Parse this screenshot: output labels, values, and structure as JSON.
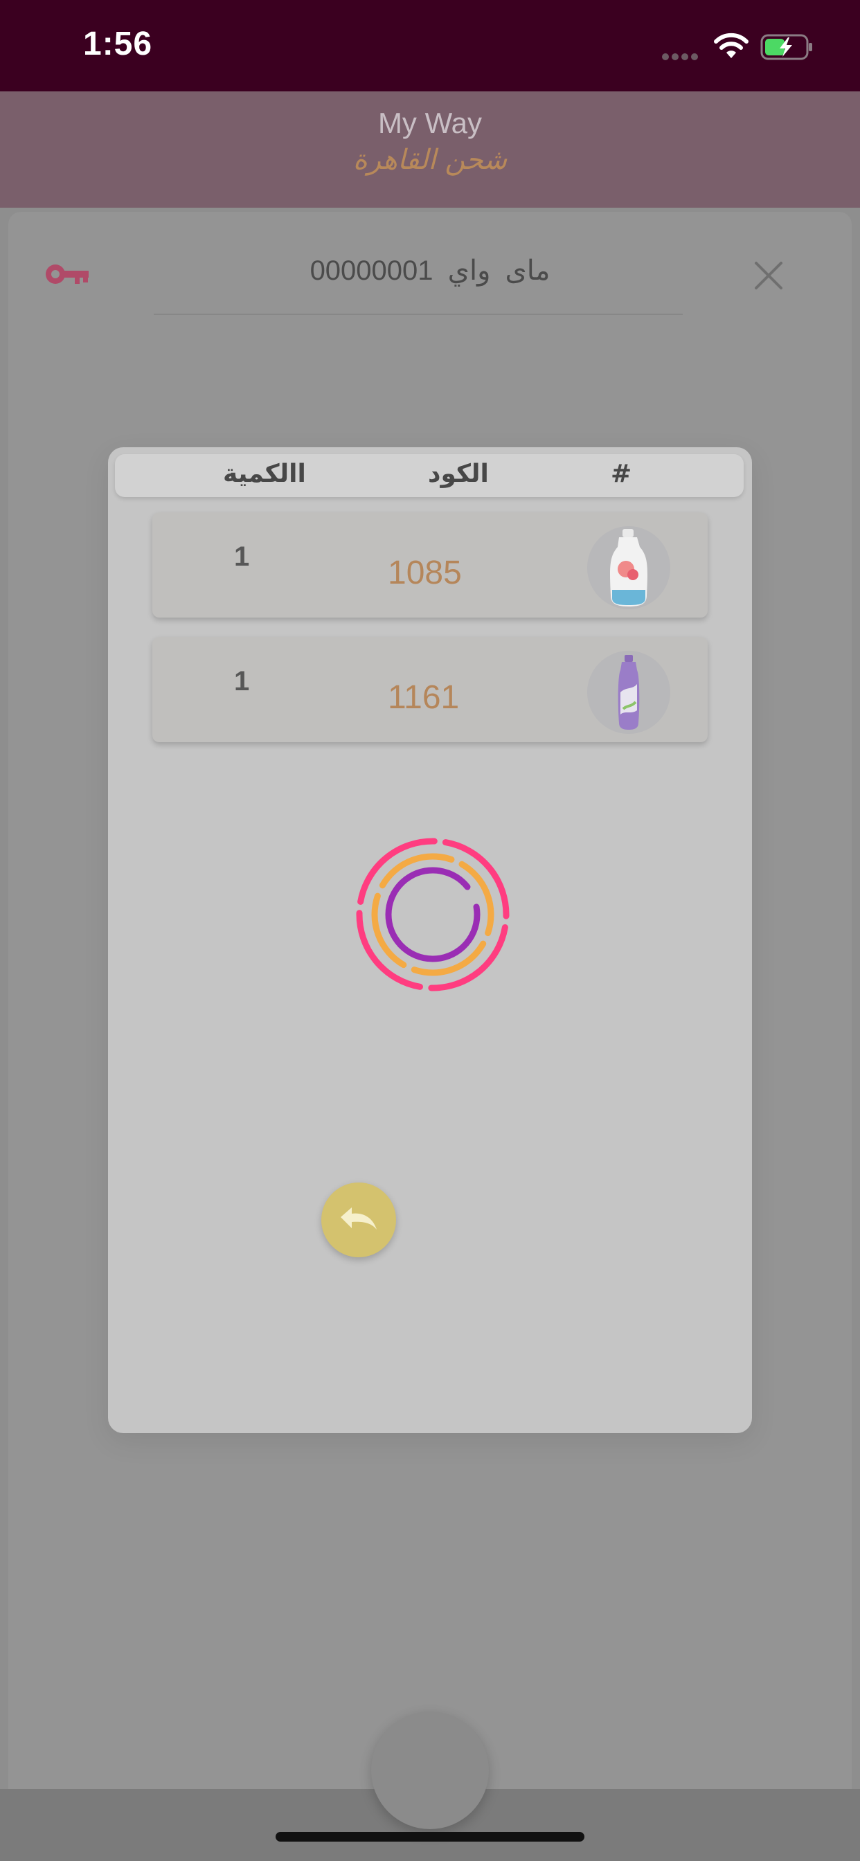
{
  "status_bar": {
    "time": "1:56",
    "icons": [
      "signal-dots-icon",
      "wifi-icon",
      "battery-charging-icon"
    ]
  },
  "header": {
    "title": "My Way",
    "subtitle": "شحن القاهرة"
  },
  "sheet": {
    "title": "ماى واي   00000001",
    "left_icon": "key-icon",
    "right_icon": "close-icon"
  },
  "table": {
    "columns": [
      "االكمية",
      "الكود",
      "#"
    ],
    "rows": [
      {
        "quantity": "1",
        "code": "1085",
        "image": "detergent-bottle-image"
      },
      {
        "quantity": "1",
        "code": "1161",
        "image": "purple-bottle-image"
      }
    ]
  },
  "loading_spinner": {
    "icon": "loading-spinner-icon",
    "colors": [
      "#ff3d80",
      "#f4aa44",
      "#9a2db4"
    ]
  },
  "back_button": {
    "icon": "undo-arrow-icon",
    "color": "#d4c26e"
  },
  "colors": {
    "status_bar": "#3b0020",
    "app_bar": "#7a5f6b",
    "accent_key": "#c0506e",
    "code_text": "#b5865a"
  }
}
